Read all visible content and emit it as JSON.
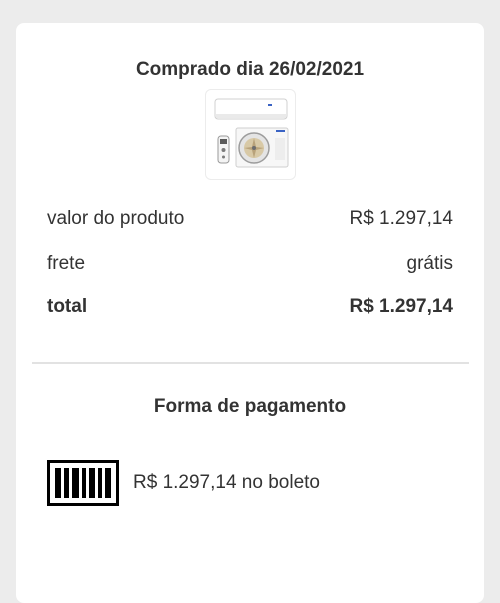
{
  "purchase": {
    "title": "Comprado dia 26/02/2021",
    "product_image_icon": "air-conditioner-image"
  },
  "prices": {
    "product_label": "valor do produto",
    "product_value": "R$ 1.297,14",
    "shipping_label": "frete",
    "shipping_value": "grátis",
    "total_label": "total",
    "total_value": "R$ 1.297,14"
  },
  "payment": {
    "title": "Forma de pagamento",
    "icon": "barcode-icon",
    "method_text": "R$ 1.297,14 no boleto"
  }
}
